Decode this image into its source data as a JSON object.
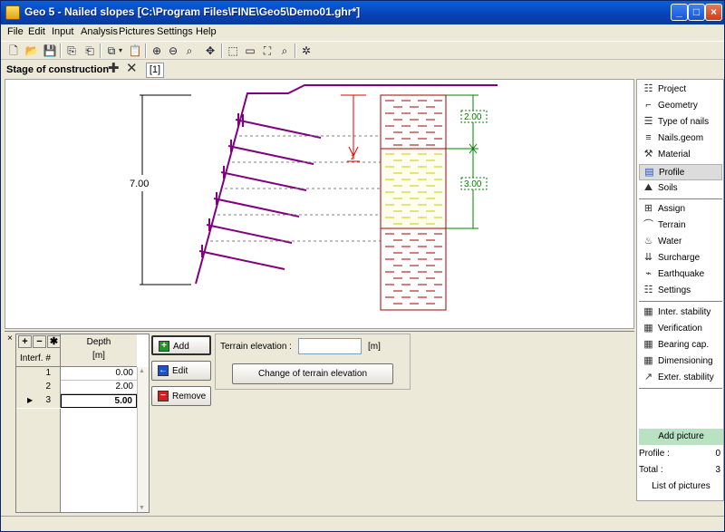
{
  "window": {
    "title": "Geo 5 - Nailed slopes [C:\\Program Files\\FINE\\Geo5\\Demo01.ghr*]"
  },
  "menu": [
    "File",
    "Edit",
    "Input",
    "Analysis",
    "Pictures",
    "Settings",
    "Help"
  ],
  "stage": {
    "label": "Stage of construction :",
    "tab": "[1]"
  },
  "drawing": {
    "height_label": "7.00",
    "dim1": "2.00",
    "dim2": "3.00",
    "z_label": "z",
    "colors": {
      "wall": "#800080",
      "layer1": "#a00000",
      "layer2": "#d0d000",
      "dim": "#008000",
      "axis": "#e00000"
    }
  },
  "sidebar": {
    "items": [
      {
        "label": "Project",
        "icon": "project-icon"
      },
      {
        "label": "Geometry",
        "icon": "geometry-icon"
      },
      {
        "label": "Type of nails",
        "icon": "nail-type-icon"
      },
      {
        "label": "Nails.geom",
        "icon": "nails-geom-icon"
      },
      {
        "label": "Material",
        "icon": "material-icon"
      },
      {
        "label": "Profile",
        "icon": "profile-icon",
        "active": true
      },
      {
        "label": "Soils",
        "icon": "soils-icon"
      },
      {
        "label": "Assign",
        "icon": "assign-icon"
      },
      {
        "label": "Terrain",
        "icon": "terrain-icon"
      },
      {
        "label": "Water",
        "icon": "water-icon"
      },
      {
        "label": "Surcharge",
        "icon": "surcharge-icon"
      },
      {
        "label": "Earthquake",
        "icon": "earthquake-icon"
      },
      {
        "label": "Settings",
        "icon": "settings-icon"
      },
      {
        "label": "Inter. stability",
        "icon": "inter-stability-icon"
      },
      {
        "label": "Verification",
        "icon": "verification-icon"
      },
      {
        "label": "Bearing cap.",
        "icon": "bearing-cap-icon"
      },
      {
        "label": "Dimensioning",
        "icon": "dimensioning-icon"
      },
      {
        "label": "Exter. stability",
        "icon": "exter-stability-icon"
      }
    ],
    "add_picture": "Add picture",
    "profile_label": "Profile :",
    "profile_count": "0",
    "total_label": "Total :",
    "total_count": "3",
    "list_pictures": "List of pictures"
  },
  "table": {
    "header_depth": "Depth",
    "header_unit": "[m]",
    "header_interf": "Interf. #",
    "rows": [
      {
        "n": "1",
        "depth": "0.00"
      },
      {
        "n": "2",
        "depth": "2.00"
      },
      {
        "n": "3",
        "depth": "5.00",
        "current": true
      }
    ]
  },
  "buttons": {
    "add": "Add",
    "edit": "Edit",
    "remove": "Remove"
  },
  "terrain": {
    "label": "Terrain elevation :",
    "value": "",
    "unit": "[m]",
    "change_button": "Change of terrain elevation"
  }
}
